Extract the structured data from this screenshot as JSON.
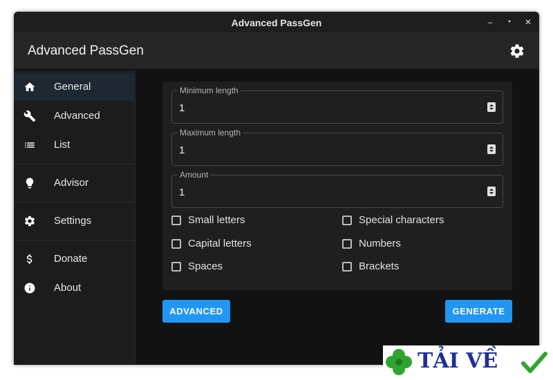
{
  "window": {
    "title": "Advanced PassGen",
    "controls": {
      "minimize": "–",
      "maximize": "▪",
      "close": "✕"
    }
  },
  "appbar": {
    "title": "Advanced PassGen",
    "settings_icon": "gear-icon"
  },
  "sidebar": {
    "items": [
      {
        "label": "General",
        "icon": "home-icon",
        "active": true
      },
      {
        "label": "Advanced",
        "icon": "wrench-icon"
      },
      {
        "label": "List",
        "icon": "list-icon"
      },
      {
        "label": "Advisor",
        "icon": "lightbulb-icon"
      },
      {
        "label": "Settings",
        "icon": "gear-icon"
      },
      {
        "label": "Donate",
        "icon": "dollar-icon"
      },
      {
        "label": "About",
        "icon": "info-icon"
      }
    ]
  },
  "form": {
    "min_length": {
      "label": "Minimum length",
      "value": "1"
    },
    "max_length": {
      "label": "Maximum length",
      "value": "1"
    },
    "amount": {
      "label": "Amount",
      "value": "1"
    },
    "options": [
      {
        "label": "Small letters",
        "checked": false
      },
      {
        "label": "Special characters",
        "checked": false
      },
      {
        "label": "Capital letters",
        "checked": false
      },
      {
        "label": "Numbers",
        "checked": false
      },
      {
        "label": "Spaces",
        "checked": false
      },
      {
        "label": "Brackets",
        "checked": false
      }
    ]
  },
  "buttons": {
    "advanced": "ADVANCED",
    "generate": "GENERATE"
  },
  "watermark": {
    "text": "TẢI VỀ"
  },
  "colors": {
    "accent": "#2196f3",
    "background": "#121212",
    "sidebar": "#1c1c1c",
    "active_item": "#1d2833"
  }
}
